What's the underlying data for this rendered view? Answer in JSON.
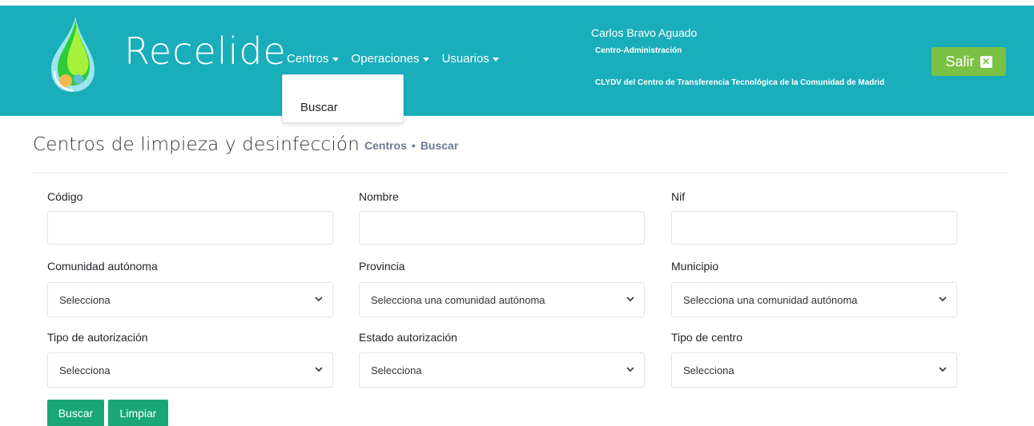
{
  "header": {
    "brand": "Recelide",
    "nav": [
      {
        "label": "Centros"
      },
      {
        "label": "Operaciones"
      },
      {
        "label": "Usuarios"
      }
    ],
    "dropdown": {
      "items": [
        "Buscar"
      ]
    },
    "user": {
      "name": "Carlos Bravo Aguado",
      "role": "Centro-Administración",
      "org": "CLYDV del Centro de Transferencia Tecnológica de la Comunidad de Madrid"
    },
    "logout_label": "Salir",
    "logout_icon": "✕"
  },
  "page": {
    "title": "Centros de limpieza y desinfección",
    "breadcrumb": [
      "Centros",
      "Buscar"
    ],
    "breadcrumb_sep": "•"
  },
  "form": {
    "codigo": {
      "label": "Código",
      "value": "",
      "placeholder": ""
    },
    "nombre": {
      "label": "Nombre",
      "value": "",
      "placeholder": ""
    },
    "nif": {
      "label": "Nif",
      "value": "",
      "placeholder": ""
    },
    "comunidad": {
      "label": "Comunidad autónoma",
      "selected": "Selecciona"
    },
    "provincia": {
      "label": "Provincia",
      "selected": "Selecciona una comunidad autónoma"
    },
    "municipio": {
      "label": "Municipio",
      "selected": "Selecciona una comunidad autónoma"
    },
    "tipo_autorizacion": {
      "label": "Tipo de autorización",
      "selected": "Selecciona"
    },
    "estado_autorizacion": {
      "label": "Estado autorización",
      "selected": "Selecciona"
    },
    "tipo_centro": {
      "label": "Tipo de centro",
      "selected": "Selecciona"
    },
    "buttons": {
      "search": "Buscar",
      "clear": "Limpiar"
    }
  },
  "colors": {
    "header_bg": "#1aaebb",
    "logout_bg": "#7bc143",
    "button_bg": "#1aa777",
    "breadcrumb": "#6c7a95"
  }
}
